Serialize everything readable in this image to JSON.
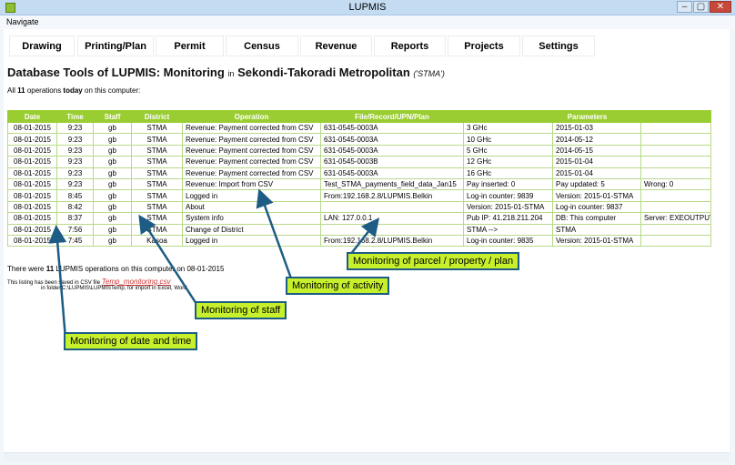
{
  "window": {
    "title": "LUPMIS",
    "min_glyph": "–",
    "max_glyph": "▢",
    "close_glyph": "✕"
  },
  "menu": {
    "navigate": "Navigate"
  },
  "nav_tabs": [
    "Drawing",
    "Printing/Plan",
    "Permit",
    "Census",
    "Revenue",
    "Reports",
    "Projects",
    "Settings"
  ],
  "heading": {
    "title": "Database Tools of LUPMIS: Monitoring",
    "in": "in",
    "district": "Sekondi-Takoradi Metropolitan",
    "code": "('STMA')"
  },
  "ops_line": {
    "prefix": "All",
    "count": "11",
    "middle": "operations",
    "today": "today",
    "suffix": "on this computer:"
  },
  "table": {
    "headers": [
      "Date",
      "Time",
      "Staff",
      "District",
      "Operation",
      "File/Record/UPN/Plan",
      "Parameters"
    ],
    "rows": [
      [
        "08-01-2015",
        "9:23",
        "gb",
        "STMA",
        "Revenue: Payment corrected from CSV",
        "631-0545-0003A",
        "3 GHc",
        "2015-01-03",
        ""
      ],
      [
        "08-01-2015",
        "9:23",
        "gb",
        "STMA",
        "Revenue: Payment corrected from CSV",
        "631-0545-0003A",
        "10 GHc",
        "2014-05-12",
        ""
      ],
      [
        "08-01-2015",
        "9:23",
        "gb",
        "STMA",
        "Revenue: Payment corrected from CSV",
        "631-0545-0003A",
        "5 GHc",
        "2014-05-15",
        ""
      ],
      [
        "08-01-2015",
        "9:23",
        "gb",
        "STMA",
        "Revenue: Payment corrected from CSV",
        "631-0545-0003B",
        "12 GHc",
        "2015-01-04",
        ""
      ],
      [
        "08-01-2015",
        "9:23",
        "gb",
        "STMA",
        "Revenue: Payment corrected from CSV",
        "631-0545-0003A",
        "16 GHc",
        "2015-01-04",
        ""
      ],
      [
        "08-01-2015",
        "9:23",
        "gb",
        "STMA",
        "Revenue: Import from CSV",
        "Test_STMA_payments_field_data_Jan15",
        "Pay inserted: 0",
        "Pay updated: 5",
        "Wrong: 0"
      ],
      [
        "08-01-2015",
        "8:45",
        "gb",
        "STMA",
        "Logged in",
        "From:192.168.2.8/LUPMIS.Belkin",
        "Log-in counter: 9839",
        "Version: 2015-01-STMA",
        ""
      ],
      [
        "08-01-2015",
        "8:42",
        "gb",
        "STMA",
        "About",
        "",
        "Version: 2015-01-STMA",
        "Log-in counter: 9837",
        ""
      ],
      [
        "08-01-2015",
        "8:37",
        "gb",
        "STMA",
        "System info",
        "LAN: 127.0.0.1",
        "Pub IP: 41.218.211.204",
        "DB: This computer",
        "Server: EXEOUTPUT"
      ],
      [
        "08-01-2015",
        "7:56",
        "gb",
        "STMA",
        "Change of District",
        "",
        "STMA -->",
        "STMA",
        ""
      ],
      [
        "08-01-2015",
        "7:45",
        "gb",
        "Kasoa",
        "Logged in",
        "From:192.168.2.8/LUPMIS.Belkin",
        "Log-in counter: 9835",
        "Version: 2015-01-STMA",
        ""
      ]
    ]
  },
  "summary": {
    "prefix": "There were",
    "count": "11",
    "suffix": "LUPMIS operations on this computer on 08-01-2015"
  },
  "saved": {
    "prefix": "This listing has been saved in CSV file",
    "file": "Temp_monitoring.csv",
    "folder_line": "in folder C:\\LUPMIS\\LUPMISTemp, for import in Excel, Word"
  },
  "callouts": {
    "parcel": "Monitoring of parcel / property / plan",
    "activity": "Monitoring of activity",
    "staff": "Monitoring of staff",
    "date_time": "Monitoring of date and time"
  },
  "colors": {
    "table_header": "#9acd32",
    "callout_fill": "#c5f02b",
    "arrow": "#1d5c84"
  }
}
